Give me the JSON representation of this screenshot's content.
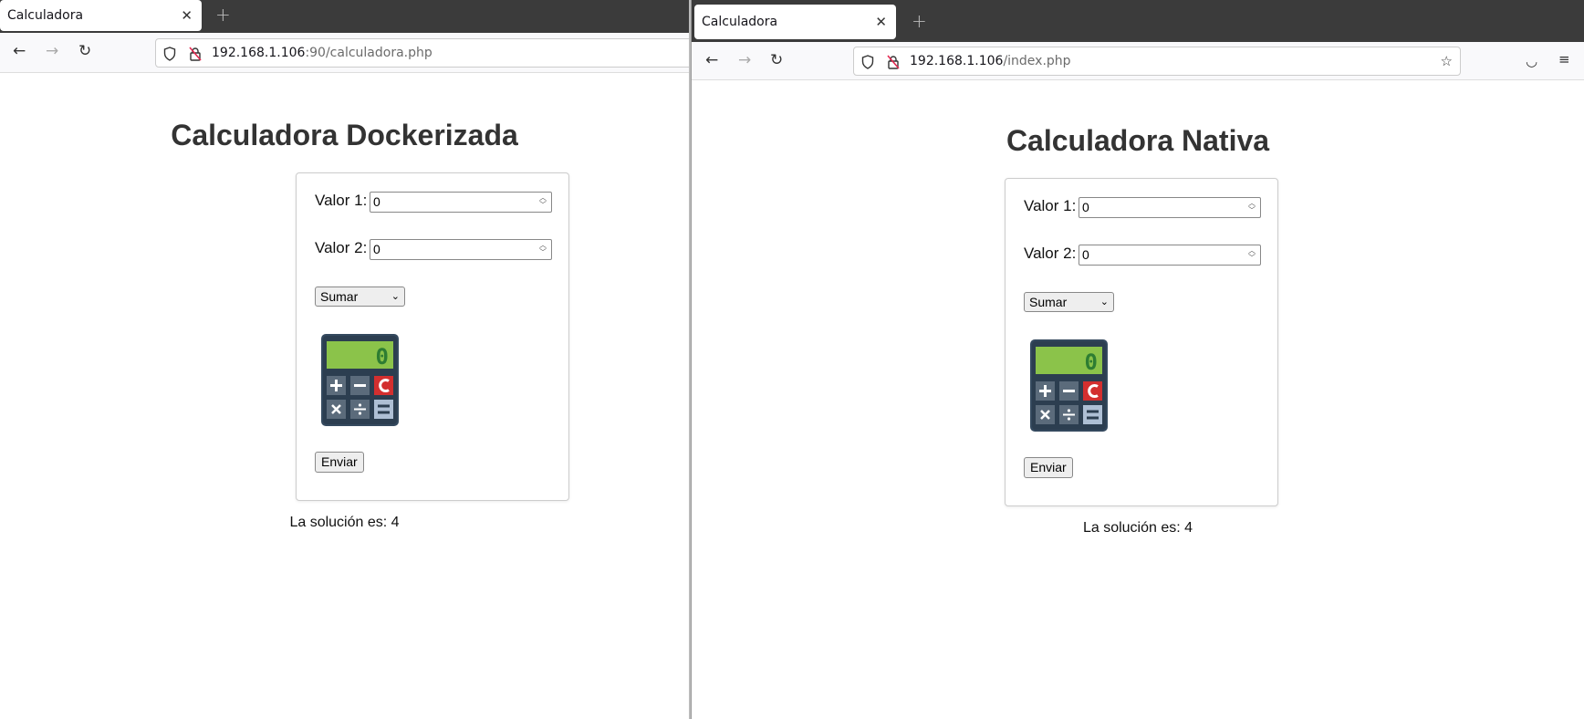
{
  "left": {
    "tab_title": "Calculadora",
    "url_host": "192.168.1.106",
    "url_path": ":90/calculadora.php",
    "heading": "Calculadora Dockerizada",
    "valor1_label": "Valor 1:",
    "valor1_value": "0",
    "valor2_label": "Valor 2:",
    "valor2_value": "0",
    "operation_selected": "Sumar",
    "submit_label": "Enviar",
    "result": "La solución es: 4",
    "calc_display": "0"
  },
  "right": {
    "tab_title": "Calculadora",
    "url_host": "192.168.1.106",
    "url_path": "/index.php",
    "heading": "Calculadora Nativa",
    "valor1_label": "Valor 1:",
    "valor1_value": "0",
    "valor2_label": "Valor 2:",
    "valor2_value": "0",
    "operation_selected": "Sumar",
    "submit_label": "Enviar",
    "result": "La solución es: 4",
    "calc_display": "0"
  },
  "icons": {
    "close": "close-icon",
    "new_tab": "plus-icon",
    "back": "back-arrow-icon",
    "forward": "forward-arrow-icon",
    "reload": "reload-icon",
    "shield": "shield-icon",
    "insecure_lock": "insecure-lock-icon",
    "bookmark": "star-icon",
    "pocket": "pocket-icon",
    "menu": "hamburger-menu-icon",
    "calculator": "calculator-icon"
  },
  "colors": {
    "tabstrip": "#3b3b3b",
    "calc_body": "#2c3e50",
    "calc_screen": "#8bc34a",
    "calc_clear": "#d32f2f"
  }
}
